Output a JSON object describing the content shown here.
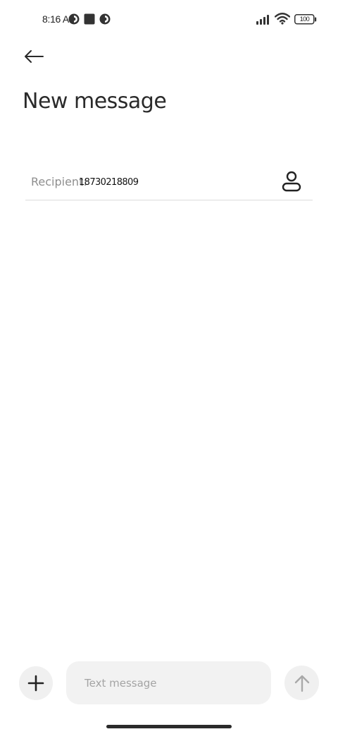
{
  "status_bar": {
    "time": "8:16 AM",
    "notification_icons": [
      "app-notification-icon",
      "square-notification-icon",
      "app-notification-icon"
    ],
    "signal_icon": "signal-bars-icon",
    "wifi_icon": "wifi-icon",
    "battery_level": "100"
  },
  "header": {
    "back_icon": "arrow-left-icon",
    "title": "New message"
  },
  "recipient": {
    "label": "Recipient:",
    "value": "18730218809",
    "contact_icon": "person-icon"
  },
  "composer": {
    "add_icon": "plus-icon",
    "placeholder": "Text message",
    "value": "",
    "send_icon": "arrow-up-icon"
  },
  "colors": {
    "background": "#ffffff",
    "text": "#222222",
    "muted": "#8e8e8e",
    "button_bg": "#f0f0f0",
    "divider": "#dcdcdc"
  }
}
